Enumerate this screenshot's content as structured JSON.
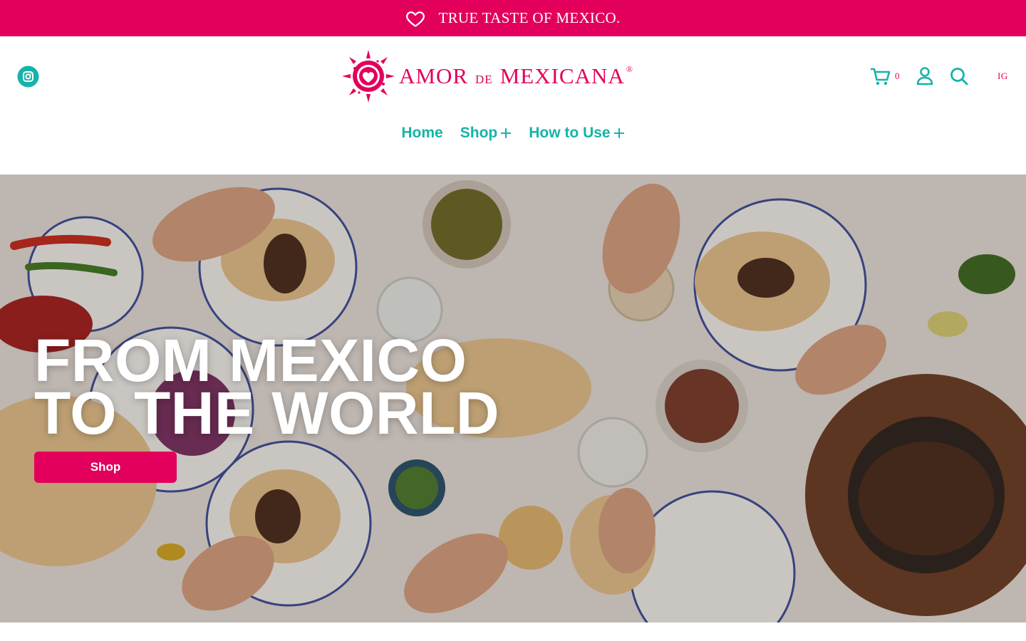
{
  "announcement": {
    "icon": "heart-outline-icon",
    "text": "TRUE TASTE OF MEXICO."
  },
  "header": {
    "social_icon": "instagram-icon",
    "logo": {
      "word1": "AMOR",
      "word2": "DE",
      "word3": "MEXICANA",
      "registered": "®"
    },
    "cart": {
      "icon": "cart-icon",
      "count": "0"
    },
    "account_icon": "user-icon",
    "search_icon": "search-icon",
    "language": "IG"
  },
  "nav": {
    "items": [
      {
        "label": "Home"
      },
      {
        "label": "Shop"
      },
      {
        "label": "How to Use"
      }
    ]
  },
  "hero": {
    "title_line1": "FROM MEXICO",
    "title_line2": "TO THE WORLD",
    "button_label": "Shop"
  },
  "colors": {
    "brand_pink": "#e2005c",
    "brand_teal": "#16b3a8",
    "white": "#ffffff"
  }
}
